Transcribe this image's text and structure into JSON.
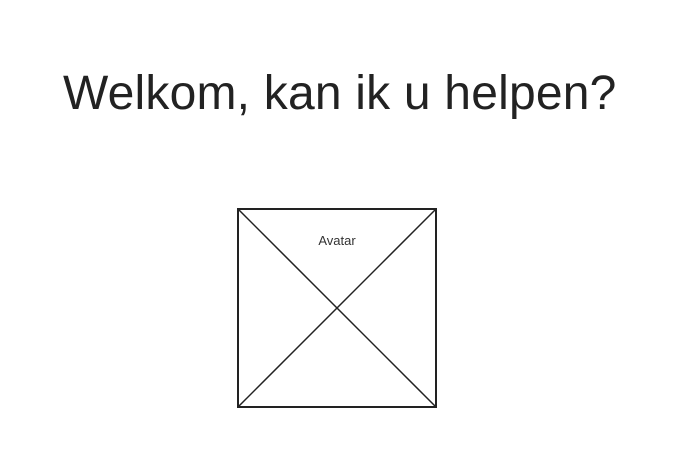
{
  "page": {
    "title": "Welkom, kan ik u helpen?"
  },
  "avatar": {
    "label": "Avatar",
    "placeholder_icon": "image-placeholder-cross-icon"
  },
  "colors": {
    "background": "#ffffff",
    "text": "#222222",
    "stroke": "#222222"
  }
}
